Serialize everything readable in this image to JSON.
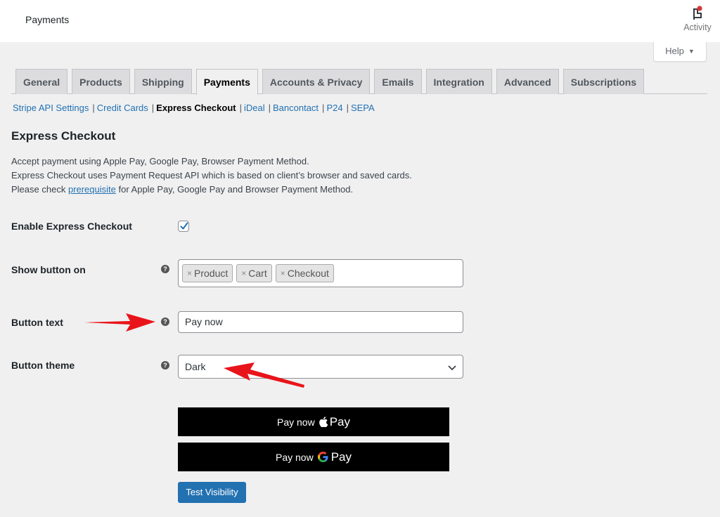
{
  "header": {
    "title": "Payments",
    "activity_label": "Activity",
    "help_label": "Help"
  },
  "tabs": [
    {
      "label": "General",
      "active": false
    },
    {
      "label": "Products",
      "active": false
    },
    {
      "label": "Shipping",
      "active": false
    },
    {
      "label": "Payments",
      "active": true
    },
    {
      "label": "Accounts & Privacy",
      "active": false
    },
    {
      "label": "Emails",
      "active": false
    },
    {
      "label": "Integration",
      "active": false
    },
    {
      "label": "Advanced",
      "active": false
    },
    {
      "label": "Subscriptions",
      "active": false
    }
  ],
  "subnav": [
    {
      "label": "Stripe API Settings",
      "current": false
    },
    {
      "label": "Credit Cards",
      "current": false
    },
    {
      "label": "Express Checkout",
      "current": true
    },
    {
      "label": "iDeal",
      "current": false
    },
    {
      "label": "Bancontact",
      "current": false
    },
    {
      "label": "P24",
      "current": false
    },
    {
      "label": "SEPA",
      "current": false
    }
  ],
  "section": {
    "title": "Express Checkout",
    "desc_line1": "Accept payment using Apple Pay, Google Pay, Browser Payment Method.",
    "desc_line2": "Express Checkout uses Payment Request API which is based on client’s browser and saved cards.",
    "desc_line3_prefix": "Please check ",
    "desc_line3_link": "prerequisite",
    "desc_line3_suffix": " for Apple Pay, Google Pay and Browser Payment Method."
  },
  "form": {
    "enable": {
      "label": "Enable Express Checkout",
      "checked": true
    },
    "show_on": {
      "label": "Show button on",
      "chips": [
        "Product",
        "Cart",
        "Checkout"
      ],
      "remove_glyph": "×"
    },
    "button_text": {
      "label": "Button text",
      "value": "Pay now"
    },
    "button_theme": {
      "label": "Button theme",
      "selected": "Dark"
    },
    "help_glyph": "?"
  },
  "preview": {
    "apple_text": "Pay now",
    "apple_brand": "Pay",
    "google_text": "Pay now",
    "google_brand": "Pay",
    "google_g": "G"
  },
  "actions": {
    "test_visibility": "Test Visibility"
  },
  "colors": {
    "accent": "#2271b1",
    "annotation_arrow": "#e8141a",
    "notification_dot": "#d63638"
  }
}
